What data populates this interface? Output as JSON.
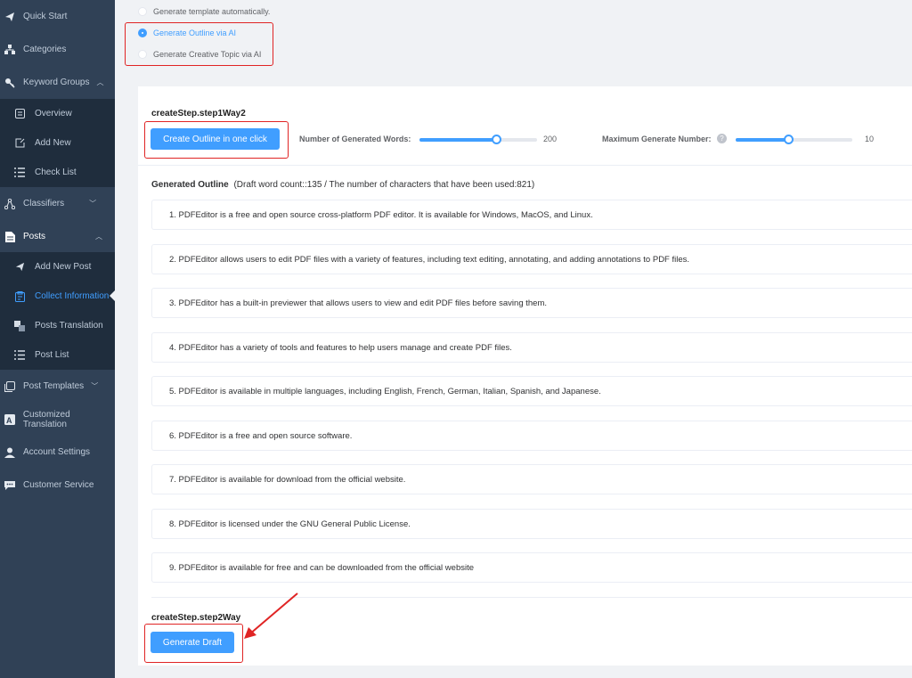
{
  "sidebar": {
    "items": [
      {
        "label": "Quick Start",
        "icon": "paper-plane-icon"
      },
      {
        "label": "Categories",
        "icon": "sitemap-icon"
      },
      {
        "label": "Keyword Groups",
        "icon": "key-icon"
      },
      {
        "label": "Overview",
        "icon": "list-box-icon"
      },
      {
        "label": "Add New",
        "icon": "edit-icon"
      },
      {
        "label": "Check List",
        "icon": "list-icon"
      },
      {
        "label": "Classifiers",
        "icon": "network-icon"
      },
      {
        "label": "Posts",
        "icon": "document-icon"
      },
      {
        "label": "Add New Post",
        "icon": "paper-plane-icon"
      },
      {
        "label": "Collect Information",
        "icon": "clipboard-icon"
      },
      {
        "label": "Posts Translation",
        "icon": "translate-icon"
      },
      {
        "label": "Post List",
        "icon": "list-icon"
      },
      {
        "label": "Post Templates",
        "icon": "copy-icon"
      },
      {
        "label": "Customized Translation",
        "icon": "translate-box-icon"
      },
      {
        "label": "Account Settings",
        "icon": "user-icon"
      },
      {
        "label": "Customer Service",
        "icon": "chat-icon"
      }
    ]
  },
  "options": {
    "auto": "Generate template automatically.",
    "outline_ai": "Generate Outline via AI",
    "topic_ai": "Generate Creative Topic via AI",
    "selected": "outline_ai"
  },
  "step1": {
    "title": "createStep.step1Way2",
    "button": "Create Outline in one click",
    "words_label": "Number of Generated Words:",
    "words_value": "200",
    "words_level": 0.65,
    "max_label": "Maximum Generate Number:",
    "max_value": "10",
    "max_level": 0.45
  },
  "outline": {
    "heading": "Generated Outline",
    "stats": "(Draft word count::135 / The number of characters that have been used:821)",
    "items": [
      "1. PDFEditor is a free and open source cross-platform PDF editor. It is available for Windows, MacOS, and Linux.",
      "2. PDFEditor allows users to edit PDF files with a variety of features, including text editing, annotating, and adding annotations to PDF files.",
      "3. PDFEditor has a built-in previewer that allows users to view and edit PDF files before saving them.",
      "4. PDFEditor has a variety of tools and features to help users manage and create PDF files.",
      "5. PDFEditor is available in multiple languages, including English, French, German, Italian, Spanish, and Japanese.",
      "6. PDFEditor is a free and open source software.",
      "7. PDFEditor is available for download from the official website.",
      "8. PDFEditor is licensed under the GNU General Public License.",
      "9. PDFEditor is available for free and can be downloaded from the official website"
    ]
  },
  "step2": {
    "title": "createStep.step2Way",
    "button": "Generate Draft"
  },
  "colors": {
    "sidebar_bg": "#304156",
    "submenu_bg": "#1f2d3d",
    "accent": "#409eff",
    "highlight": "#e02424"
  }
}
